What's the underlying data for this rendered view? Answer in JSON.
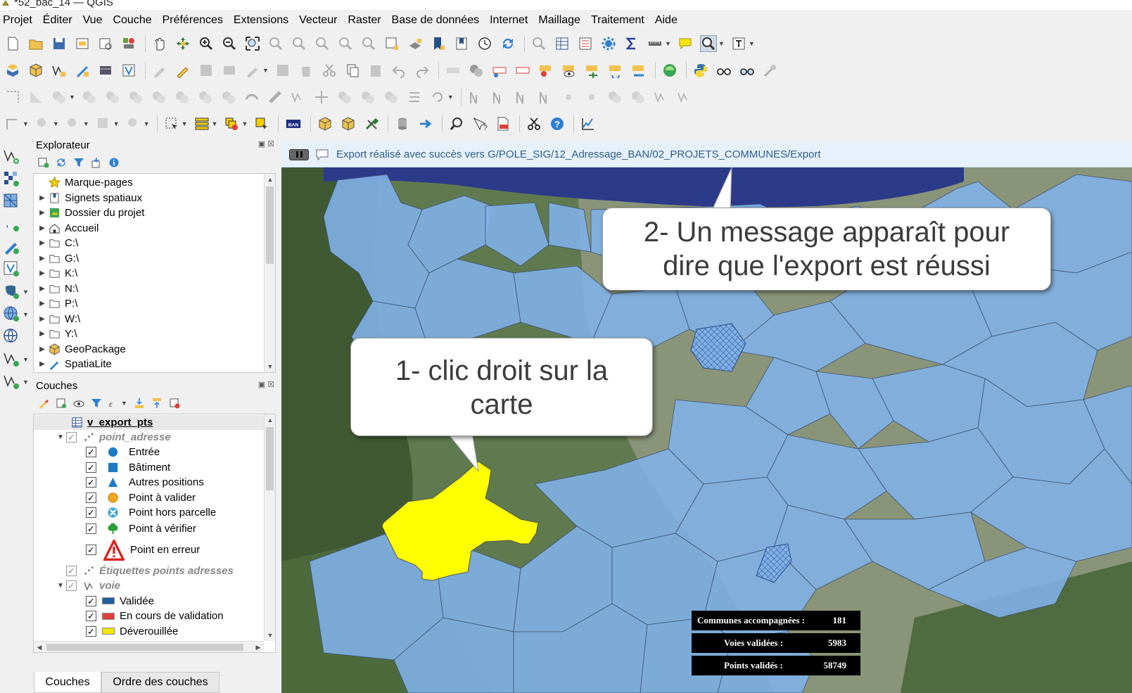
{
  "window": {
    "title": "*52_bac_14 — QGIS"
  },
  "menu": [
    "Projet",
    "Éditer",
    "Vue",
    "Couche",
    "Préférences",
    "Extensions",
    "Vecteur",
    "Raster",
    "Base de données",
    "Internet",
    "Maillage",
    "Traitement",
    "Aide"
  ],
  "toolbars": {
    "ban_label": "BAN"
  },
  "explorer": {
    "title": "Explorateur",
    "items": [
      {
        "label": "Marque-pages",
        "icon": "star-icon",
        "expandable": false
      },
      {
        "label": "Signets spatiaux",
        "icon": "bookmark-icon",
        "expandable": true
      },
      {
        "label": "Dossier du projet",
        "icon": "project-folder-icon",
        "expandable": true
      },
      {
        "label": "Accueil",
        "icon": "home-icon",
        "expandable": true
      },
      {
        "label": "C:\\",
        "icon": "folder-icon",
        "expandable": true
      },
      {
        "label": "G:\\",
        "icon": "folder-icon",
        "expandable": true
      },
      {
        "label": "K:\\",
        "icon": "folder-icon",
        "expandable": true
      },
      {
        "label": "N:\\",
        "icon": "folder-icon",
        "expandable": true
      },
      {
        "label": "P:\\",
        "icon": "folder-icon",
        "expandable": true
      },
      {
        "label": "W:\\",
        "icon": "folder-icon",
        "expandable": true
      },
      {
        "label": "Y:\\",
        "icon": "folder-icon",
        "expandable": true
      },
      {
        "label": "GeoPackage",
        "icon": "geopackage-icon",
        "expandable": true
      },
      {
        "label": "SpatiaLite",
        "icon": "spatialite-icon",
        "expandable": true
      }
    ]
  },
  "layers": {
    "title": "Couches",
    "top_layer": "v_export_pts",
    "group_point": "point_adresse",
    "point_classes": [
      {
        "label": "Entrée",
        "symbol": "circle-blue-icon"
      },
      {
        "label": "Bâtiment",
        "symbol": "square-blue-icon"
      },
      {
        "label": "Autres positions",
        "symbol": "triangle-blue-icon"
      },
      {
        "label": "Point à valider",
        "symbol": "circle-orange-icon"
      },
      {
        "label": "Point hors parcelle",
        "symbol": "cross-circle-icon"
      },
      {
        "label": "Point à vérifier",
        "symbol": "tree-green-icon"
      },
      {
        "label": "Point en erreur",
        "symbol": "warning-icon"
      }
    ],
    "labels_layer": "Étiquettes points adresses",
    "group_voie": "voie",
    "voie_classes": [
      {
        "label": "Validée",
        "color": "#1f5f9e"
      },
      {
        "label": "En cours de validation",
        "color": "#d9413a"
      },
      {
        "label": "Déverouillée",
        "color": "#f5e50a"
      }
    ]
  },
  "tabs": [
    "Couches",
    "Ordre des couches"
  ],
  "message": {
    "text": "Export réalisé avec succès vers G/POLE_SIG/12_Adressage_BAN/02_PROJETS_COMMUNES/Export"
  },
  "callouts": {
    "one": {
      "line1": "1- clic droit sur la",
      "line2": "carte"
    },
    "two": {
      "line1": "2- Un message apparaît pour",
      "line2": "dire que l'export est réussi"
    }
  },
  "stats": [
    {
      "label": "Communes accompagnées :",
      "value": "181"
    },
    {
      "label": "Voies validées :",
      "value": "5983"
    },
    {
      "label": "Points validés :",
      "value": "58749"
    }
  ],
  "colors": {
    "commune_fill": "#7fb0e6",
    "selected_commune": "#ffff00",
    "sea": "#2c3a8a",
    "message_text": "#2f5d8c"
  }
}
